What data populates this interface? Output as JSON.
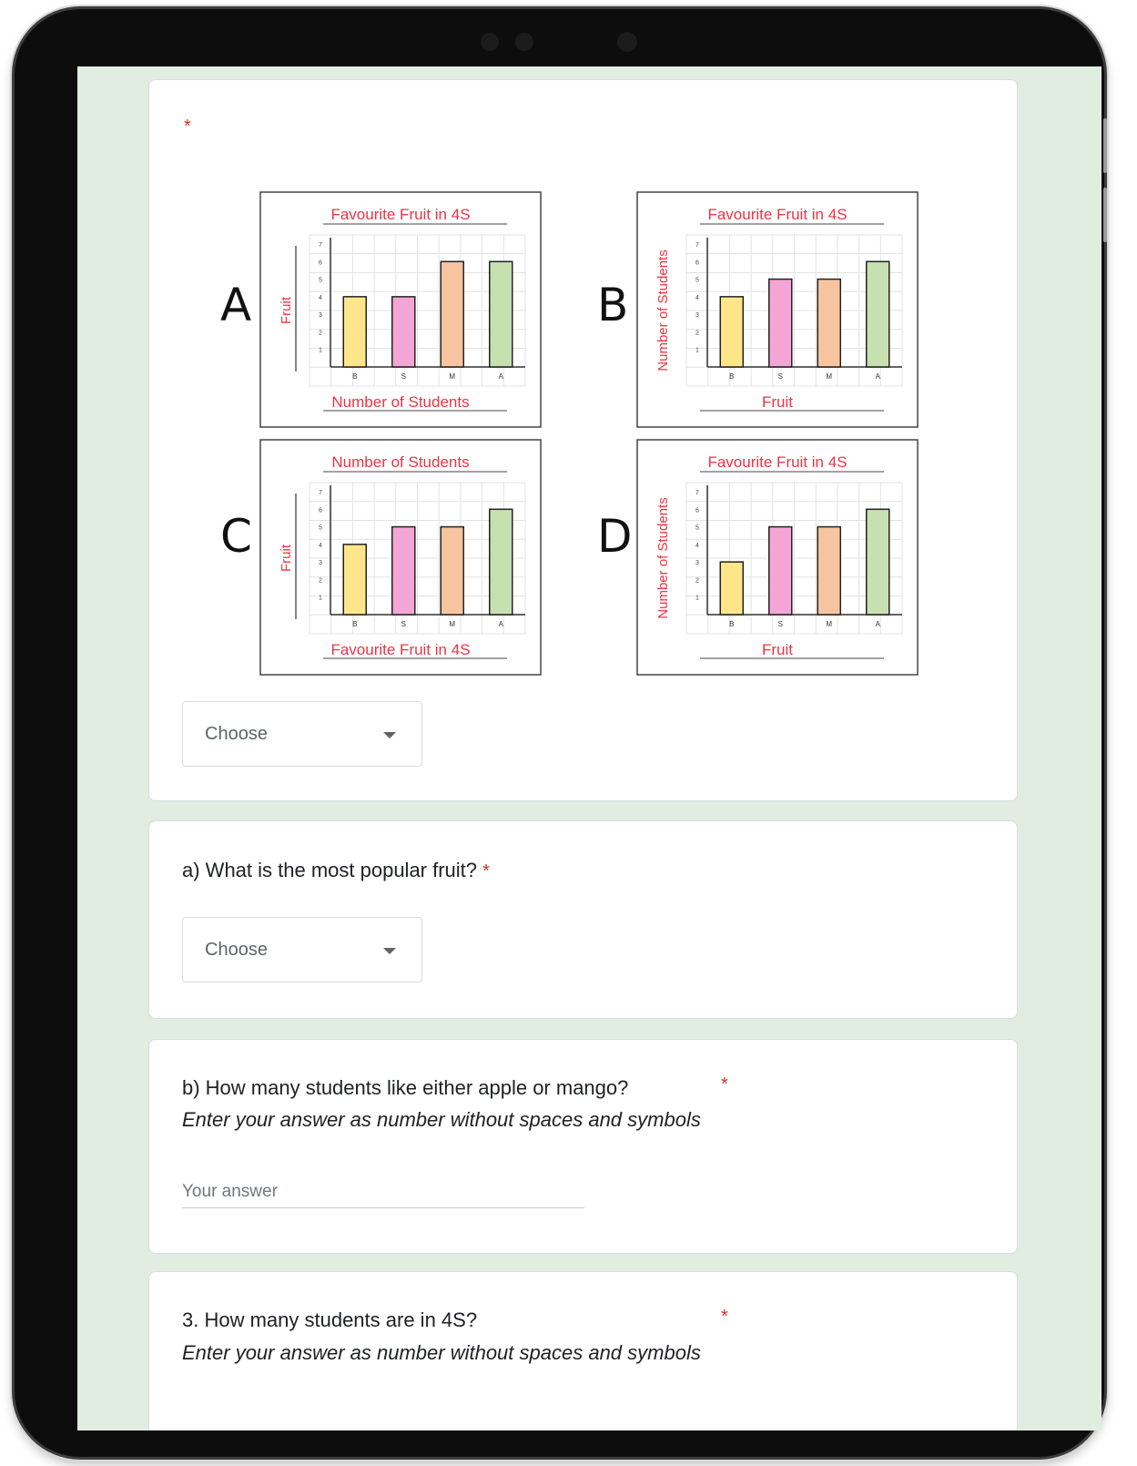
{
  "colors": {
    "required": "#d93025",
    "chart_text": "#ee3344",
    "bar_banana": "#fde68a",
    "bar_strawberry": "#f3a6d6",
    "bar_mango": "#f6c5a0",
    "bar_apple": "#c6e0b0"
  },
  "question_image": {
    "required_marker": "*",
    "options": [
      {
        "letter": "A",
        "title": "Favourite Fruit in 4S",
        "xlabel": "Number of Students",
        "ylabel": "Fruit"
      },
      {
        "letter": "B",
        "title": "Favourite Fruit in 4S",
        "xlabel": "Fruit",
        "ylabel": "Number of Students"
      },
      {
        "letter": "C",
        "title": "Number of Students",
        "xlabel": "Favourite Fruit in 4S",
        "ylabel": "Fruit"
      },
      {
        "letter": "D",
        "title": "Favourite Fruit in 4S",
        "xlabel": "Fruit",
        "ylabel": "Number of Students"
      }
    ],
    "dropdown_label": "Choose"
  },
  "chart_data": [
    {
      "type": "bar",
      "title": "Favourite Fruit in 4S",
      "xlabel": "Number of Students",
      "ylabel": "Fruit",
      "categories": [
        "B",
        "S",
        "M",
        "A"
      ],
      "values": [
        4,
        4,
        6,
        6
      ],
      "yticks": [
        "1",
        "2",
        "3",
        "4",
        "5",
        "6",
        "7"
      ],
      "ylim": [
        0,
        7
      ]
    },
    {
      "type": "bar",
      "title": "Favourite Fruit in 4S",
      "xlabel": "Fruit",
      "ylabel": "Number of Students",
      "categories": [
        "B",
        "S",
        "M",
        "A"
      ],
      "values": [
        4,
        5,
        5,
        6
      ],
      "yticks": [
        "1",
        "2",
        "3",
        "4",
        "5",
        "6",
        "7"
      ],
      "ylim": [
        0,
        7
      ]
    },
    {
      "type": "bar",
      "title": "Number of Students",
      "xlabel": "Favourite Fruit in 4S",
      "ylabel": "Fruit",
      "categories": [
        "B",
        "S",
        "M",
        "A"
      ],
      "values": [
        4,
        5,
        5,
        6
      ],
      "yticks": [
        "1",
        "2",
        "3",
        "4",
        "5",
        "6",
        "7"
      ],
      "ylim": [
        0,
        7
      ]
    },
    {
      "type": "bar",
      "title": "Favourite Fruit in 4S",
      "xlabel": "Fruit",
      "ylabel": "Number of Students",
      "categories": [
        "B",
        "S",
        "M",
        "A"
      ],
      "values": [
        3,
        5,
        5,
        6
      ],
      "yticks": [
        "1",
        "2",
        "3",
        "4",
        "5",
        "6",
        "7"
      ],
      "ylim": [
        0,
        7
      ]
    }
  ],
  "question_a": {
    "title": "a) What is the most popular fruit?",
    "required_marker": "*",
    "dropdown_label": "Choose"
  },
  "question_b": {
    "title": "b) How many students like either apple or mango?",
    "required_marker": "*",
    "help": "Enter your answer as number without spaces and symbols",
    "placeholder": "Your answer"
  },
  "question_3": {
    "title": "3. How many students are in 4S?",
    "required_marker": "*",
    "help": "Enter your answer as number without spaces and symbols"
  }
}
